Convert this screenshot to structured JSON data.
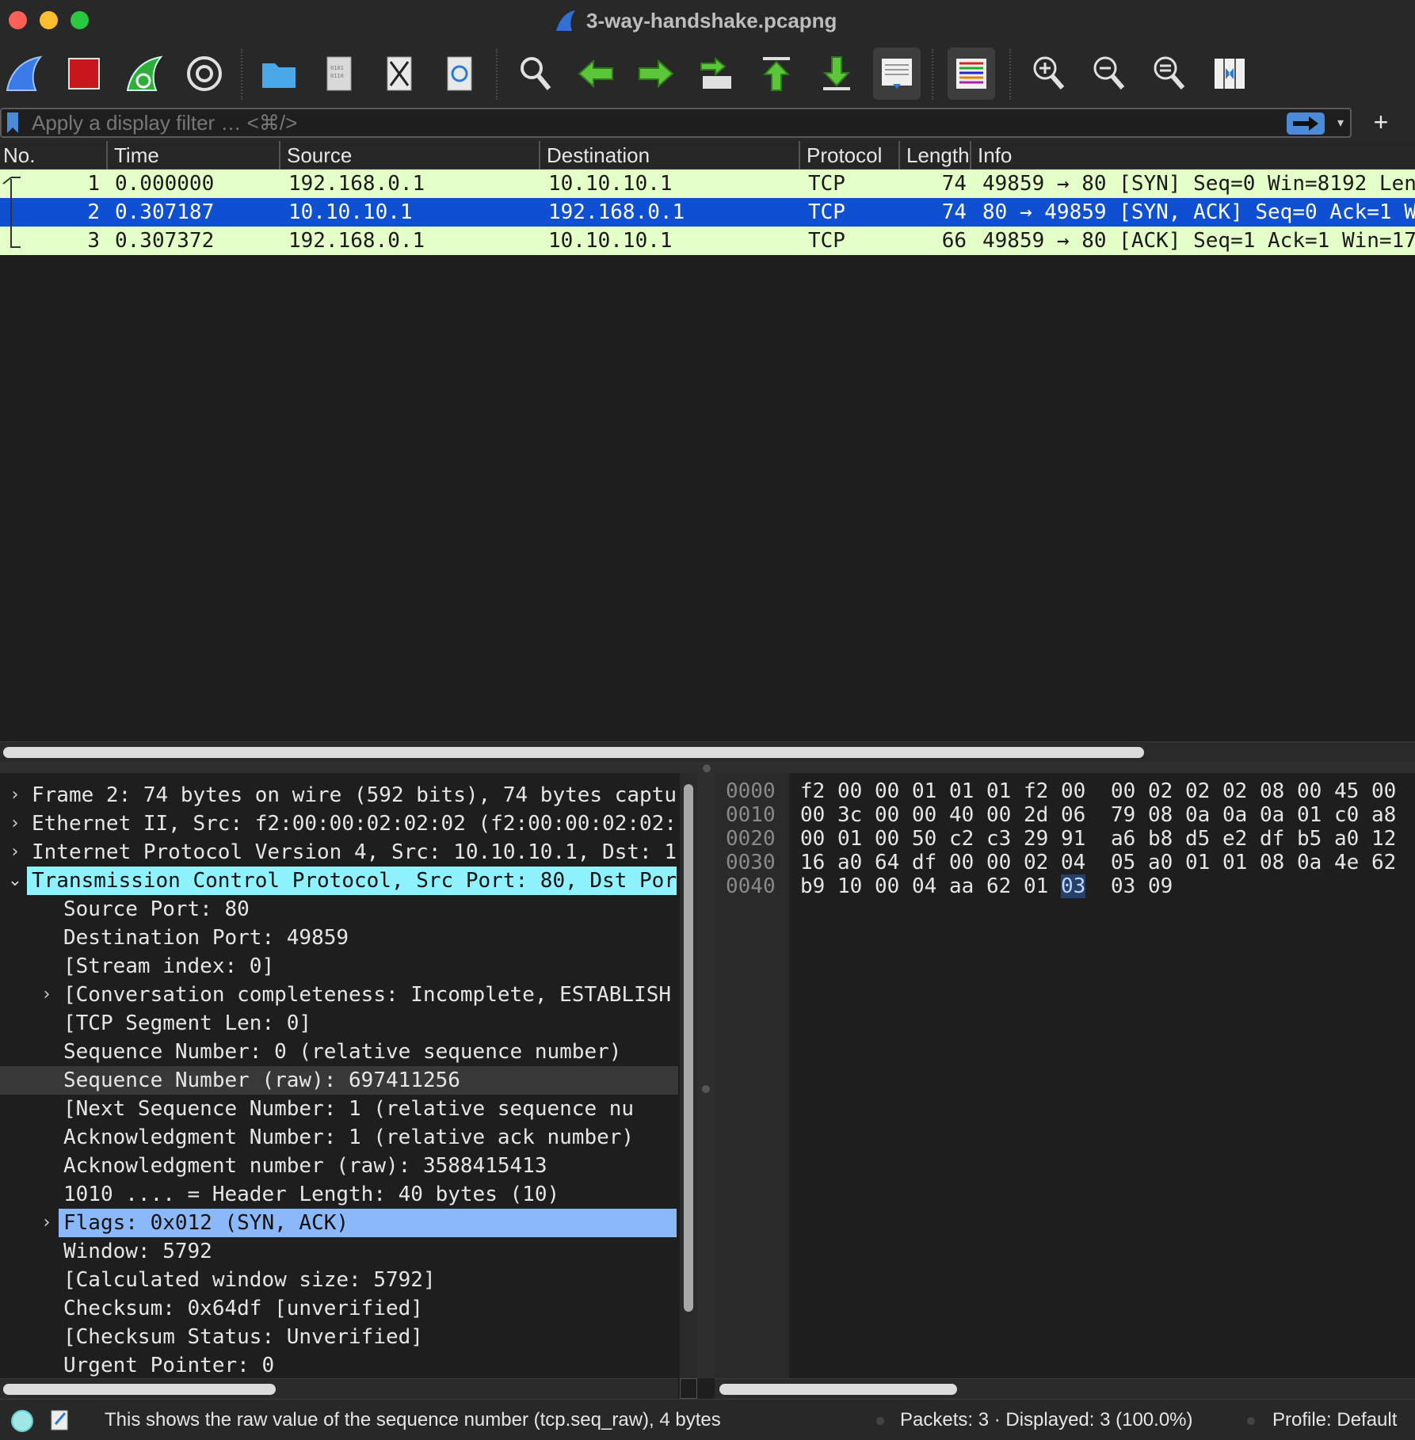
{
  "window": {
    "title": "3-way-handshake.pcapng"
  },
  "filter": {
    "placeholder": "Apply a display filter … <⌘/>",
    "value": ""
  },
  "packet_list": {
    "columns": [
      "No.",
      "Time",
      "Source",
      "Destination",
      "Protocol",
      "Length",
      "Info"
    ],
    "rows": [
      {
        "no": "1",
        "time": "0.000000",
        "source": "192.168.0.1",
        "destination": "10.10.10.1",
        "protocol": "TCP",
        "length": "74",
        "info": "49859 → 80 [SYN] Seq=0 Win=8192 Len"
      },
      {
        "no": "2",
        "time": "0.307187",
        "source": "10.10.10.1",
        "destination": "192.168.0.1",
        "protocol": "TCP",
        "length": "74",
        "info": "80 → 49859 [SYN, ACK] Seq=0 Ack=1 W"
      },
      {
        "no": "3",
        "time": "0.307372",
        "source": "192.168.0.1",
        "destination": "10.10.10.1",
        "protocol": "TCP",
        "length": "66",
        "info": "49859 → 80 [ACK] Seq=1 Ack=1 Win=17"
      }
    ]
  },
  "details": {
    "rows": [
      {
        "text": "Frame 2: 74 bytes on wire (592 bits), 74 bytes captu",
        "chevron": "›"
      },
      {
        "text": "Ethernet II, Src: f2:00:00:02:02:02 (f2:00:00:02:02:",
        "chevron": "›"
      },
      {
        "text": "Internet Protocol Version 4, Src: 10.10.10.1, Dst: 1",
        "chevron": "›"
      },
      {
        "text": "Transmission Control Protocol, Src Port: 80, Dst Por",
        "chevron": "⌄"
      },
      {
        "text": "Source Port: 80"
      },
      {
        "text": "Destination Port: 49859"
      },
      {
        "text": "[Stream index: 0]"
      },
      {
        "text": "[Conversation completeness: Incomplete, ESTABLISH",
        "chevron": "›"
      },
      {
        "text": "[TCP Segment Len: 0]"
      },
      {
        "text": "Sequence Number: 0    (relative sequence number)"
      },
      {
        "text": "Sequence Number (raw): 697411256"
      },
      {
        "text": "[Next Sequence Number: 1    (relative sequence nu"
      },
      {
        "text": "Acknowledgment Number: 1    (relative ack number)"
      },
      {
        "text": "Acknowledgment number (raw): 3588415413"
      },
      {
        "text": "1010 .... = Header Length: 40 bytes (10)"
      },
      {
        "text": "Flags: 0x012 (SYN, ACK)",
        "chevron": "›"
      },
      {
        "text": "Window: 5792"
      },
      {
        "text": "[Calculated window size: 5792]"
      },
      {
        "text": "Checksum: 0x64df [unverified]"
      },
      {
        "text": "[Checksum Status: Unverified]"
      },
      {
        "text": "Urgent Pointer: 0"
      }
    ]
  },
  "hex": {
    "rows": [
      {
        "offset": "0000",
        "bytes": [
          "f2",
          "00",
          "00",
          "01",
          "01",
          "01",
          "f2",
          "00",
          "00",
          "02",
          "02",
          "02",
          "08",
          "00",
          "45",
          "00"
        ]
      },
      {
        "offset": "0010",
        "bytes": [
          "00",
          "3c",
          "00",
          "00",
          "40",
          "00",
          "2d",
          "06",
          "79",
          "08",
          "0a",
          "0a",
          "0a",
          "01",
          "c0",
          "a8"
        ]
      },
      {
        "offset": "0020",
        "bytes": [
          "00",
          "01",
          "00",
          "50",
          "c2",
          "c3",
          "29",
          "91",
          "a6",
          "b8",
          "d5",
          "e2",
          "df",
          "b5",
          "a0",
          "12"
        ]
      },
      {
        "offset": "0030",
        "bytes": [
          "16",
          "a0",
          "64",
          "df",
          "00",
          "00",
          "02",
          "04",
          "05",
          "a0",
          "01",
          "01",
          "08",
          "0a",
          "4e",
          "62"
        ]
      },
      {
        "offset": "0040",
        "bytes": [
          "b9",
          "10",
          "00",
          "04",
          "aa",
          "62",
          "01",
          "03",
          "03",
          "09"
        ]
      }
    ],
    "selected_byte": "03"
  },
  "status": {
    "message": "This shows the raw value of the sequence number (tcp.seq_raw), 4 bytes",
    "packets": "Packets: 3 · Displayed: 3 (100.0%)",
    "profile": "Profile: Default"
  },
  "colors": {
    "tcp_row": "#e4ffc7",
    "selected_row": "#0f4fd1",
    "tcp_highlight": "#8ff3ff",
    "flags_highlight": "#8ab8f8"
  },
  "icons": {
    "toolbar": [
      "start-capture-icon",
      "stop-capture-icon",
      "restart-capture-icon",
      "capture-options-icon",
      "open-file-icon",
      "save-file-icon",
      "close-file-icon",
      "reload-file-icon",
      "find-packet-icon",
      "go-back-icon",
      "go-forward-icon",
      "go-to-packet-icon",
      "go-first-packet-icon",
      "go-last-packet-icon",
      "auto-scroll-icon",
      "colorize-icon",
      "zoom-in-icon",
      "zoom-out-icon",
      "normal-size-icon",
      "resize-columns-icon"
    ]
  }
}
